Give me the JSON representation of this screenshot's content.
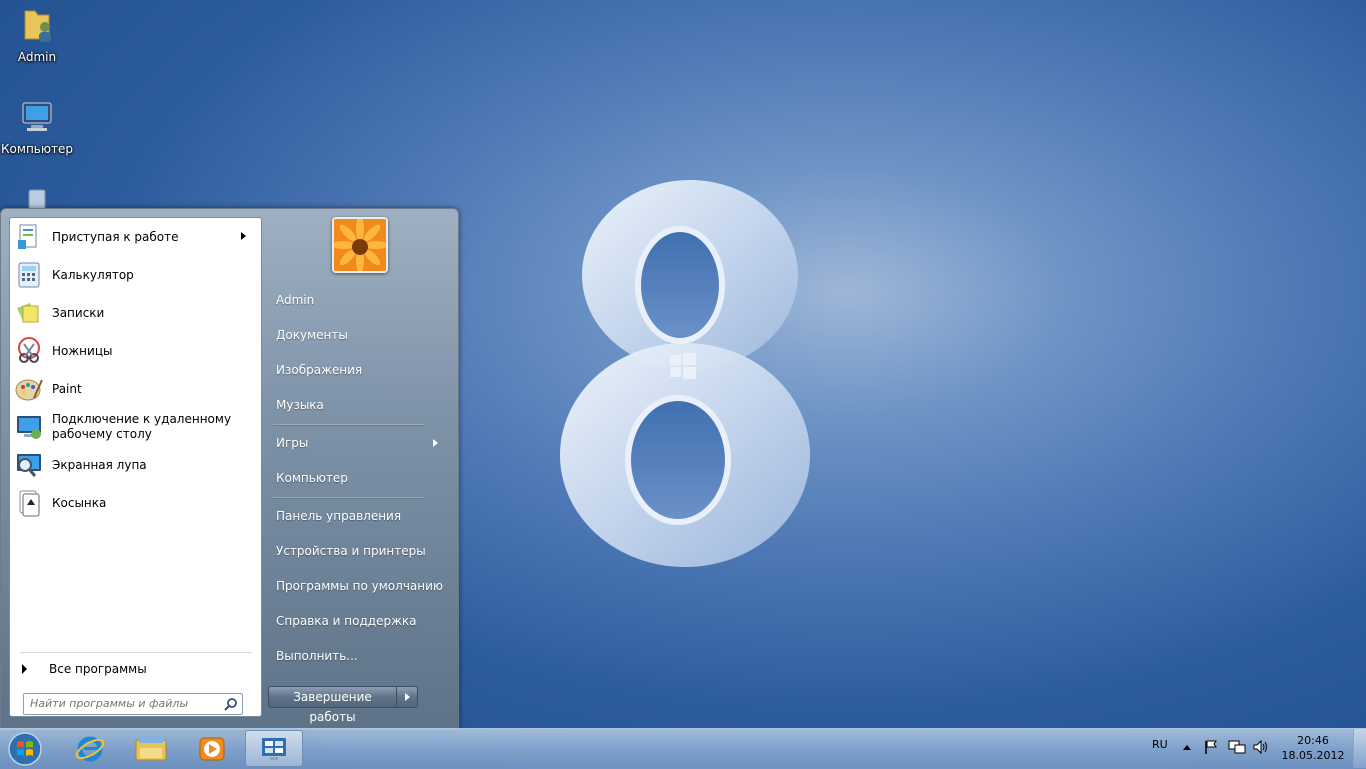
{
  "desktop": {
    "icons": [
      {
        "label": "Admin",
        "icon": "user-folder-icon"
      },
      {
        "label": "Компьютер",
        "icon": "computer-icon"
      },
      {
        "label": "",
        "icon": "recycle-bin-icon"
      }
    ]
  },
  "start_menu": {
    "programs": [
      {
        "label": "Приступая к работе",
        "icon": "getting-started-icon",
        "has_submenu": true
      },
      {
        "label": "Калькулятор",
        "icon": "calculator-icon"
      },
      {
        "label": "Записки",
        "icon": "sticky-notes-icon"
      },
      {
        "label": "Ножницы",
        "icon": "scissors-icon"
      },
      {
        "label": "Paint",
        "icon": "paint-palette-icon"
      },
      {
        "label": "Подключение к удаленному рабочему столу",
        "icon": "remote-desktop-icon"
      },
      {
        "label": "Экранная лупа",
        "icon": "magnifier-icon"
      },
      {
        "label": "Косынка",
        "icon": "solitaire-icon"
      }
    ],
    "all_programs": "Все программы",
    "search_placeholder": "Найти программы и файлы",
    "user_picture": "flower-user-picture",
    "right_items": [
      {
        "label": "Admin"
      },
      {
        "label": "Документы"
      },
      {
        "label": "Изображения"
      },
      {
        "label": "Музыка"
      },
      {
        "label": "Игры",
        "has_submenu": true
      },
      {
        "label": "Компьютер"
      },
      {
        "label": "Панель управления"
      },
      {
        "label": "Устройства и принтеры"
      },
      {
        "label": "Программы по умолчанию"
      },
      {
        "label": "Справка и поддержка"
      },
      {
        "label": "Выполнить..."
      }
    ],
    "shutdown_label": "Завершение работы"
  },
  "taskbar": {
    "pinned": [
      "start-orb",
      "internet-explorer-icon",
      "file-explorer-icon",
      "media-player-icon",
      "control-panel-icon"
    ],
    "language": "RU",
    "time": "20:46",
    "date": "18.05.2012"
  },
  "colors": {
    "desktop_bg": "#2d5c9e",
    "start_right_pane": "#6f8399",
    "taskbar": "#a9c2e0"
  }
}
